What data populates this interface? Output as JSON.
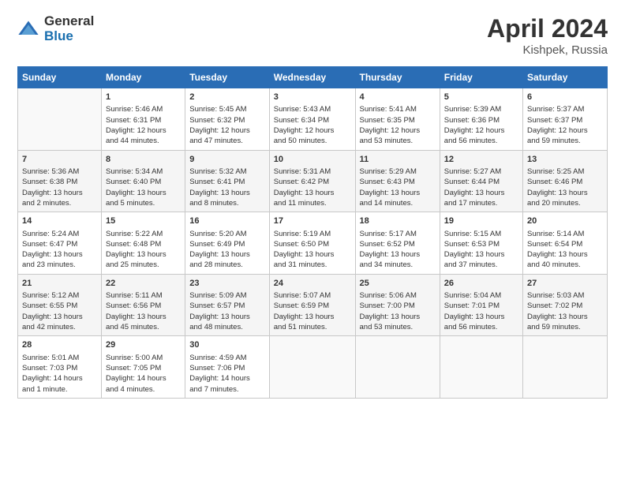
{
  "header": {
    "logo_general": "General",
    "logo_blue": "Blue",
    "title": "April 2024",
    "location": "Kishpek, Russia"
  },
  "days_of_week": [
    "Sunday",
    "Monday",
    "Tuesday",
    "Wednesday",
    "Thursday",
    "Friday",
    "Saturday"
  ],
  "weeks": [
    [
      {
        "num": "",
        "info": ""
      },
      {
        "num": "1",
        "info": "Sunrise: 5:46 AM\nSunset: 6:31 PM\nDaylight: 12 hours\nand 44 minutes."
      },
      {
        "num": "2",
        "info": "Sunrise: 5:45 AM\nSunset: 6:32 PM\nDaylight: 12 hours\nand 47 minutes."
      },
      {
        "num": "3",
        "info": "Sunrise: 5:43 AM\nSunset: 6:34 PM\nDaylight: 12 hours\nand 50 minutes."
      },
      {
        "num": "4",
        "info": "Sunrise: 5:41 AM\nSunset: 6:35 PM\nDaylight: 12 hours\nand 53 minutes."
      },
      {
        "num": "5",
        "info": "Sunrise: 5:39 AM\nSunset: 6:36 PM\nDaylight: 12 hours\nand 56 minutes."
      },
      {
        "num": "6",
        "info": "Sunrise: 5:37 AM\nSunset: 6:37 PM\nDaylight: 12 hours\nand 59 minutes."
      }
    ],
    [
      {
        "num": "7",
        "info": "Sunrise: 5:36 AM\nSunset: 6:38 PM\nDaylight: 13 hours\nand 2 minutes."
      },
      {
        "num": "8",
        "info": "Sunrise: 5:34 AM\nSunset: 6:40 PM\nDaylight: 13 hours\nand 5 minutes."
      },
      {
        "num": "9",
        "info": "Sunrise: 5:32 AM\nSunset: 6:41 PM\nDaylight: 13 hours\nand 8 minutes."
      },
      {
        "num": "10",
        "info": "Sunrise: 5:31 AM\nSunset: 6:42 PM\nDaylight: 13 hours\nand 11 minutes."
      },
      {
        "num": "11",
        "info": "Sunrise: 5:29 AM\nSunset: 6:43 PM\nDaylight: 13 hours\nand 14 minutes."
      },
      {
        "num": "12",
        "info": "Sunrise: 5:27 AM\nSunset: 6:44 PM\nDaylight: 13 hours\nand 17 minutes."
      },
      {
        "num": "13",
        "info": "Sunrise: 5:25 AM\nSunset: 6:46 PM\nDaylight: 13 hours\nand 20 minutes."
      }
    ],
    [
      {
        "num": "14",
        "info": "Sunrise: 5:24 AM\nSunset: 6:47 PM\nDaylight: 13 hours\nand 23 minutes."
      },
      {
        "num": "15",
        "info": "Sunrise: 5:22 AM\nSunset: 6:48 PM\nDaylight: 13 hours\nand 25 minutes."
      },
      {
        "num": "16",
        "info": "Sunrise: 5:20 AM\nSunset: 6:49 PM\nDaylight: 13 hours\nand 28 minutes."
      },
      {
        "num": "17",
        "info": "Sunrise: 5:19 AM\nSunset: 6:50 PM\nDaylight: 13 hours\nand 31 minutes."
      },
      {
        "num": "18",
        "info": "Sunrise: 5:17 AM\nSunset: 6:52 PM\nDaylight: 13 hours\nand 34 minutes."
      },
      {
        "num": "19",
        "info": "Sunrise: 5:15 AM\nSunset: 6:53 PM\nDaylight: 13 hours\nand 37 minutes."
      },
      {
        "num": "20",
        "info": "Sunrise: 5:14 AM\nSunset: 6:54 PM\nDaylight: 13 hours\nand 40 minutes."
      }
    ],
    [
      {
        "num": "21",
        "info": "Sunrise: 5:12 AM\nSunset: 6:55 PM\nDaylight: 13 hours\nand 42 minutes."
      },
      {
        "num": "22",
        "info": "Sunrise: 5:11 AM\nSunset: 6:56 PM\nDaylight: 13 hours\nand 45 minutes."
      },
      {
        "num": "23",
        "info": "Sunrise: 5:09 AM\nSunset: 6:57 PM\nDaylight: 13 hours\nand 48 minutes."
      },
      {
        "num": "24",
        "info": "Sunrise: 5:07 AM\nSunset: 6:59 PM\nDaylight: 13 hours\nand 51 minutes."
      },
      {
        "num": "25",
        "info": "Sunrise: 5:06 AM\nSunset: 7:00 PM\nDaylight: 13 hours\nand 53 minutes."
      },
      {
        "num": "26",
        "info": "Sunrise: 5:04 AM\nSunset: 7:01 PM\nDaylight: 13 hours\nand 56 minutes."
      },
      {
        "num": "27",
        "info": "Sunrise: 5:03 AM\nSunset: 7:02 PM\nDaylight: 13 hours\nand 59 minutes."
      }
    ],
    [
      {
        "num": "28",
        "info": "Sunrise: 5:01 AM\nSunset: 7:03 PM\nDaylight: 14 hours\nand 1 minute."
      },
      {
        "num": "29",
        "info": "Sunrise: 5:00 AM\nSunset: 7:05 PM\nDaylight: 14 hours\nand 4 minutes."
      },
      {
        "num": "30",
        "info": "Sunrise: 4:59 AM\nSunset: 7:06 PM\nDaylight: 14 hours\nand 7 minutes."
      },
      {
        "num": "",
        "info": ""
      },
      {
        "num": "",
        "info": ""
      },
      {
        "num": "",
        "info": ""
      },
      {
        "num": "",
        "info": ""
      }
    ]
  ]
}
